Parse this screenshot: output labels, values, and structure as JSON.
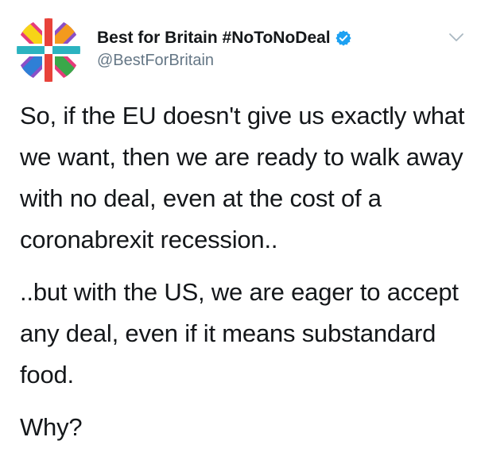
{
  "tweet": {
    "display_name": "Best for Britain #NoToNoDeal",
    "handle": "@BestForBritain",
    "paragraphs": [
      "So, if the EU doesn't give us exactly what we want, then we are ready to walk away with no deal, even at the cost of a coronabrexit recession..",
      "..but with the US, we are eager to accept any deal, even if it means substandard food.",
      "Why?"
    ]
  },
  "icons": {
    "avatar": "rainbow-union-flag-logo",
    "verified": "verified-badge-icon",
    "more": "chevron-down-icon"
  },
  "colors": {
    "text": "#14171a",
    "secondary": "#657786",
    "verified_blue": "#1da1f2",
    "chevron": "#aab8c2"
  }
}
